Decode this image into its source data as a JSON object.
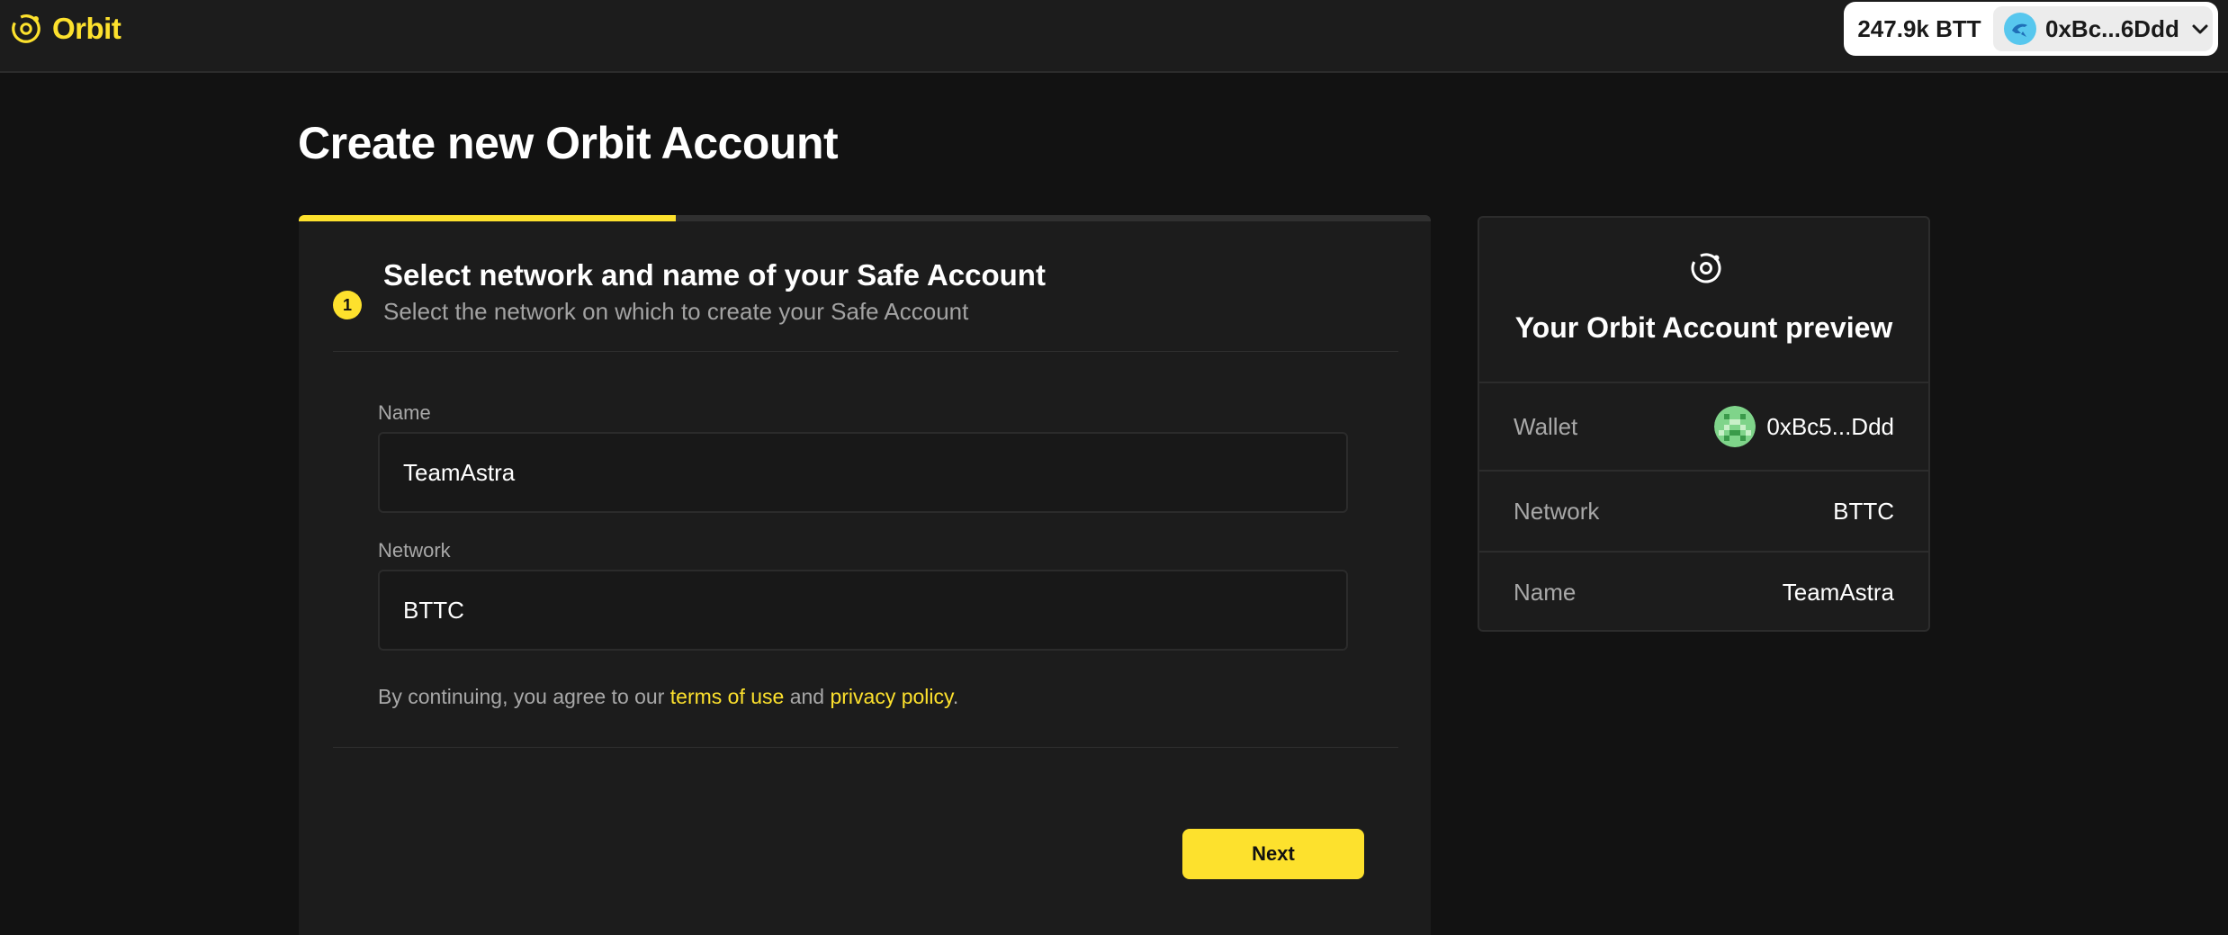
{
  "header": {
    "brand_name": "Orbit",
    "balance": "247.9k BTT",
    "account_address": "0xBc...6Ddd",
    "brand_color": "#fde12d"
  },
  "page": {
    "title": "Create new Orbit Account"
  },
  "step": {
    "number": "1",
    "title": "Select network and name of your Safe Account",
    "subtitle": "Select the network on which to create your Safe Account",
    "progress_fraction": 0.333
  },
  "form": {
    "name_label": "Name",
    "name_value": "TeamAstra",
    "network_label": "Network",
    "network_value": "BTTC",
    "terms_prefix": "By continuing, you agree to our ",
    "terms_link": "terms of use",
    "terms_middle": " and ",
    "privacy_link": "privacy policy",
    "terms_suffix": ".",
    "next_label": "Next"
  },
  "preview": {
    "title": "Your Orbit Account preview",
    "wallet_label": "Wallet",
    "wallet_value": "0xBc5...Ddd",
    "network_label": "Network",
    "network_value": "BTTC",
    "name_label": "Name",
    "name_value": "TeamAstra"
  },
  "icons": {
    "brand": "orbit-logo-icon",
    "account_avatar": "dolphin-avatar-icon",
    "chevron": "chevron-down-icon",
    "wallet_avatar": "pixel-identicon-icon"
  }
}
